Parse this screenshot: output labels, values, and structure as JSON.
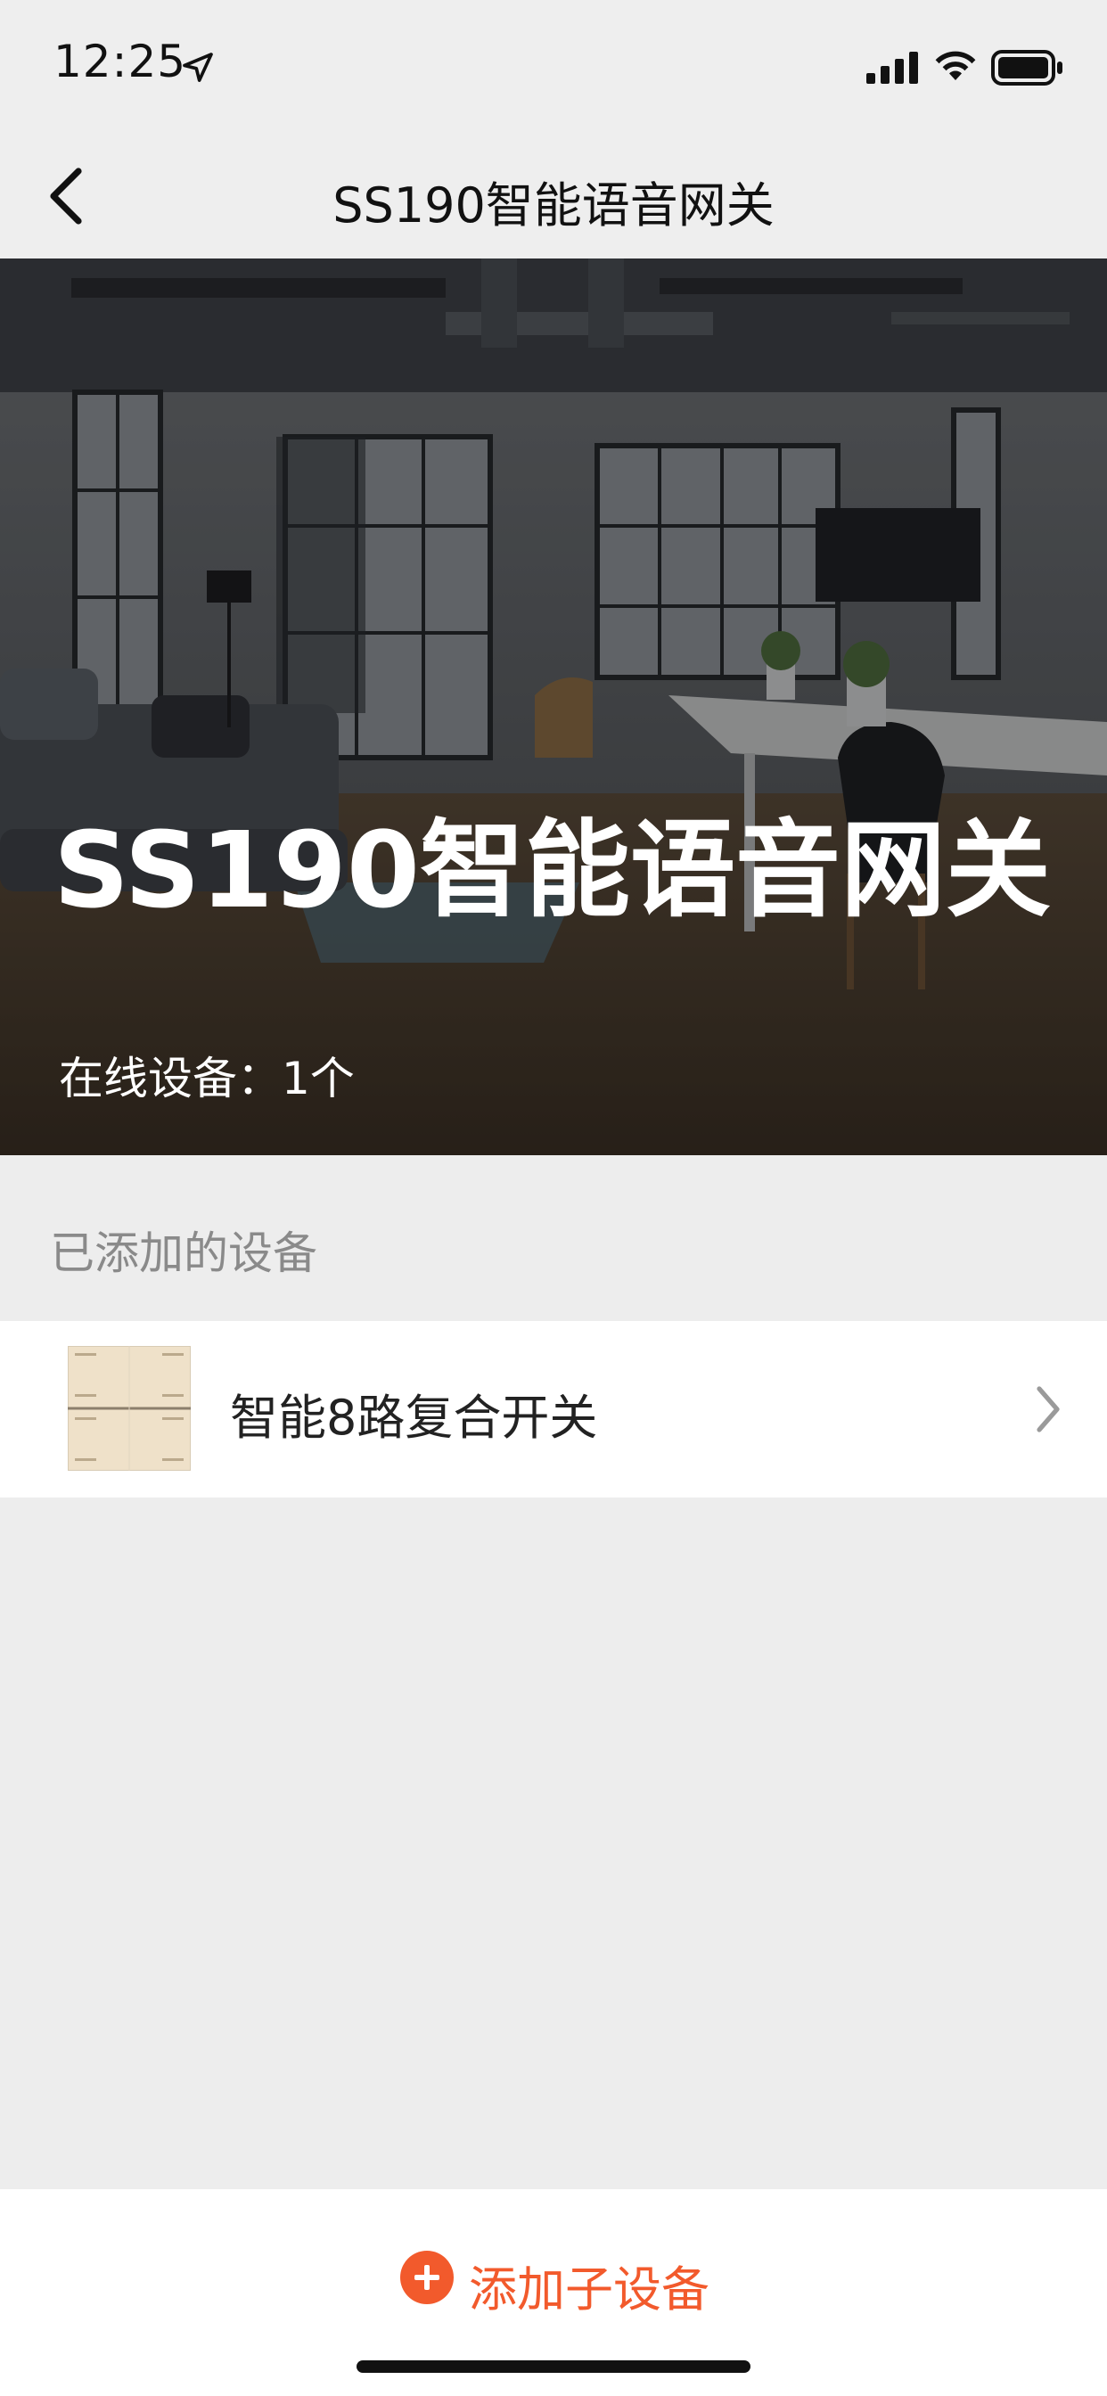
{
  "status_bar": {
    "time": "12:25",
    "icons": [
      "location-arrow-icon",
      "cellular-signal-icon",
      "wifi-icon",
      "battery-icon"
    ]
  },
  "nav": {
    "title": "SS190智能语音网关",
    "back_icon": "chevron-left-icon"
  },
  "hero": {
    "title": "SS190智能语音网关",
    "online_devices": "在线设备：1个"
  },
  "section": {
    "added_devices_label": "已添加的设备"
  },
  "devices": [
    {
      "name": "智能8路复合开关",
      "icon": "chevron-right-icon"
    }
  ],
  "bottom": {
    "add_label": "添加子设备",
    "add_icon": "plus-circle-icon",
    "accent_color": "#f25a2c"
  }
}
